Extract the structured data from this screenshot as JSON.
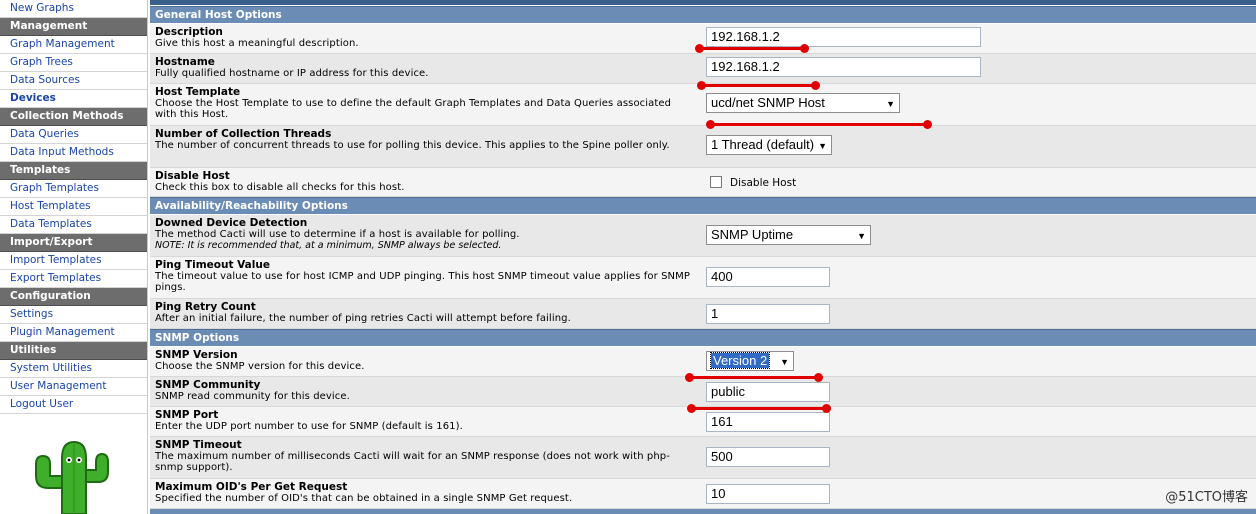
{
  "sidebar": {
    "items": [
      {
        "type": "item",
        "label": "New Graphs",
        "name": "nav-new-graphs"
      },
      {
        "type": "header",
        "label": "Management",
        "name": "nav-header-management"
      },
      {
        "type": "item",
        "label": "Graph Management",
        "name": "nav-graph-management"
      },
      {
        "type": "item",
        "label": "Graph Trees",
        "name": "nav-graph-trees"
      },
      {
        "type": "item",
        "label": "Data Sources",
        "name": "nav-data-sources"
      },
      {
        "type": "item",
        "label": "Devices",
        "name": "nav-devices",
        "active": true
      },
      {
        "type": "header",
        "label": "Collection Methods",
        "name": "nav-header-collection-methods"
      },
      {
        "type": "item",
        "label": "Data Queries",
        "name": "nav-data-queries"
      },
      {
        "type": "item",
        "label": "Data Input Methods",
        "name": "nav-data-input-methods"
      },
      {
        "type": "header",
        "label": "Templates",
        "name": "nav-header-templates"
      },
      {
        "type": "item",
        "label": "Graph Templates",
        "name": "nav-graph-templates"
      },
      {
        "type": "item",
        "label": "Host Templates",
        "name": "nav-host-templates"
      },
      {
        "type": "item",
        "label": "Data Templates",
        "name": "nav-data-templates"
      },
      {
        "type": "header",
        "label": "Import/Export",
        "name": "nav-header-import-export"
      },
      {
        "type": "item",
        "label": "Import Templates",
        "name": "nav-import-templates"
      },
      {
        "type": "item",
        "label": "Export Templates",
        "name": "nav-export-templates"
      },
      {
        "type": "header",
        "label": "Configuration",
        "name": "nav-header-configuration"
      },
      {
        "type": "item",
        "label": "Settings",
        "name": "nav-settings"
      },
      {
        "type": "item",
        "label": "Plugin Management",
        "name": "nav-plugin-management"
      },
      {
        "type": "header",
        "label": "Utilities",
        "name": "nav-header-utilities"
      },
      {
        "type": "item",
        "label": "System Utilities",
        "name": "nav-system-utilities"
      },
      {
        "type": "item",
        "label": "User Management",
        "name": "nav-user-management"
      },
      {
        "type": "item",
        "label": "Logout User",
        "name": "nav-logout-user"
      }
    ],
    "logo_icon": "cactus-logo-icon"
  },
  "sections": {
    "general": "General Host Options",
    "availability": "Availability/Reachability Options",
    "snmp": "SNMP Options"
  },
  "fields": {
    "description": {
      "title": "Description",
      "desc": "Give this host a meaningful description.",
      "value": "192.168.1.2"
    },
    "hostname": {
      "title": "Hostname",
      "desc": "Fully qualified hostname or IP address for this device.",
      "value": "192.168.1.2"
    },
    "host_template": {
      "title": "Host Template",
      "desc": "Choose the Host Template to use to define the default Graph Templates and Data Queries associated with this Host.",
      "value": "ucd/net SNMP Host"
    },
    "threads": {
      "title": "Number of Collection Threads",
      "desc": "The number of concurrent threads to use for polling this device. This applies to the Spine poller only.",
      "value": "1 Thread (default)"
    },
    "disable_host": {
      "title": "Disable Host",
      "desc": "Check this box to disable all checks for this host.",
      "label": "Disable Host",
      "checked": false
    },
    "downed_detection": {
      "title": "Downed Device Detection",
      "desc": "The method Cacti will use to determine if a host is available for polling.",
      "note": "NOTE: It is recommended that, at a minimum, SNMP always be selected.",
      "value": "SNMP Uptime"
    },
    "ping_timeout": {
      "title": "Ping Timeout Value",
      "desc": "The timeout value to use for host ICMP and UDP pinging. This host SNMP timeout value applies for SNMP pings.",
      "value": "400"
    },
    "ping_retry": {
      "title": "Ping Retry Count",
      "desc": "After an initial failure, the number of ping retries Cacti will attempt before failing.",
      "value": "1"
    },
    "snmp_version": {
      "title": "SNMP Version",
      "desc": "Choose the SNMP version for this device.",
      "value": "Version 2"
    },
    "snmp_community": {
      "title": "SNMP Community",
      "desc": "SNMP read community for this device.",
      "value": "public"
    },
    "snmp_port": {
      "title": "SNMP Port",
      "desc": "Enter the UDP port number to use for SNMP (default is 161).",
      "value": "161"
    },
    "snmp_timeout": {
      "title": "SNMP Timeout",
      "desc": "The maximum number of milliseconds Cacti will wait for an SNMP response (does not work with php-snmp support).",
      "value": "500"
    },
    "max_oids": {
      "title": "Maximum OID's Per Get Request",
      "desc": "Specified the number of OID's that can be obtained in a single SNMP Get request.",
      "value": "10"
    }
  },
  "watermark": "@51CTO博客",
  "colors": {
    "annotation": "#e00000",
    "section": "#6b8db5",
    "link": "#1a44a8"
  }
}
